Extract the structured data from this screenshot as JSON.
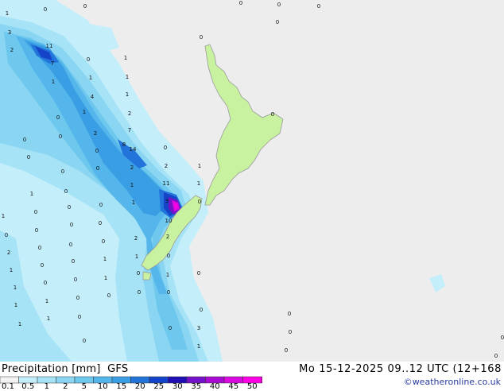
{
  "title": {
    "left": "Precipitation [mm]  GFS",
    "right": "Mo 15-12-2025 09..12 UTC (12+168"
  },
  "credit": "©weatheronline.co.uk",
  "legend": {
    "ticks": [
      "0.1",
      "0.5",
      "1",
      "2",
      "5",
      "10",
      "15",
      "20",
      "25",
      "30",
      "35",
      "40",
      "45",
      "50"
    ],
    "colors": [
      "#f2f2f2",
      "#c4eefa",
      "#a6e3f6",
      "#8ad6f2",
      "#6ec8ee",
      "#54b6ea",
      "#3a9ee4",
      "#2274da",
      "#1644c8",
      "#2010b4",
      "#7412c8",
      "#a80cd2",
      "#d80ade",
      "#ff00e6"
    ]
  },
  "map": {
    "sea_color": "#ededed",
    "land_color": "#c8f2a0",
    "labels": [
      {
        "t": "0"
      },
      {
        "t": "0"
      },
      {
        "t": "0"
      },
      {
        "t": "0"
      },
      {
        "t": "0"
      },
      {
        "t": "0"
      },
      {
        "t": "1"
      },
      {
        "t": "3"
      },
      {
        "t": "2"
      },
      {
        "t": "11"
      },
      {
        "t": "7"
      },
      {
        "t": "1"
      },
      {
        "t": "0"
      },
      {
        "t": "0"
      },
      {
        "t": "1"
      },
      {
        "t": "1"
      },
      {
        "t": "1"
      },
      {
        "t": "4"
      },
      {
        "t": "1"
      },
      {
        "t": "1"
      },
      {
        "t": "2"
      },
      {
        "t": "2"
      },
      {
        "t": "0"
      },
      {
        "t": "7"
      },
      {
        "t": "0"
      },
      {
        "t": "0"
      },
      {
        "t": "0"
      },
      {
        "t": "8"
      },
      {
        "t": "14"
      },
      {
        "t": "0"
      },
      {
        "t": "0"
      },
      {
        "t": "0"
      },
      {
        "t": "2"
      },
      {
        "t": "2"
      },
      {
        "t": "1"
      },
      {
        "t": "0"
      },
      {
        "t": "11"
      },
      {
        "t": "1"
      },
      {
        "t": "1"
      },
      {
        "t": "0"
      },
      {
        "t": "0"
      },
      {
        "t": "1"
      },
      {
        "t": "1"
      },
      {
        "t": "0"
      },
      {
        "t": "3"
      },
      {
        "t": "0"
      },
      {
        "t": "0"
      },
      {
        "t": "0"
      },
      {
        "t": "10"
      },
      {
        "t": "0"
      },
      {
        "t": "1"
      },
      {
        "t": "0"
      },
      {
        "t": "0"
      },
      {
        "t": "0"
      },
      {
        "t": "2"
      },
      {
        "t": "2"
      },
      {
        "t": "2"
      },
      {
        "t": "0"
      },
      {
        "t": "0"
      },
      {
        "t": "1"
      },
      {
        "t": "0"
      },
      {
        "t": "0"
      },
      {
        "t": "1"
      },
      {
        "t": "0"
      },
      {
        "t": "0"
      },
      {
        "t": "1"
      },
      {
        "t": "1"
      },
      {
        "t": "0"
      },
      {
        "t": "0"
      },
      {
        "t": "0"
      },
      {
        "t": "0"
      },
      {
        "t": "1"
      },
      {
        "t": "0"
      },
      {
        "t": "0"
      },
      {
        "t": "1"
      },
      {
        "t": "0"
      },
      {
        "t": "0"
      },
      {
        "t": "1"
      },
      {
        "t": "1"
      },
      {
        "t": "1"
      },
      {
        "t": "0"
      },
      {
        "t": "0"
      },
      {
        "t": "3"
      },
      {
        "t": "0"
      },
      {
        "t": "1"
      },
      {
        "t": "0"
      },
      {
        "t": "0"
      },
      {
        "t": "0"
      },
      {
        "t": "0"
      },
      {
        "t": "0"
      },
      {
        "t": "0"
      },
      {
        "t": "1"
      }
    ]
  }
}
